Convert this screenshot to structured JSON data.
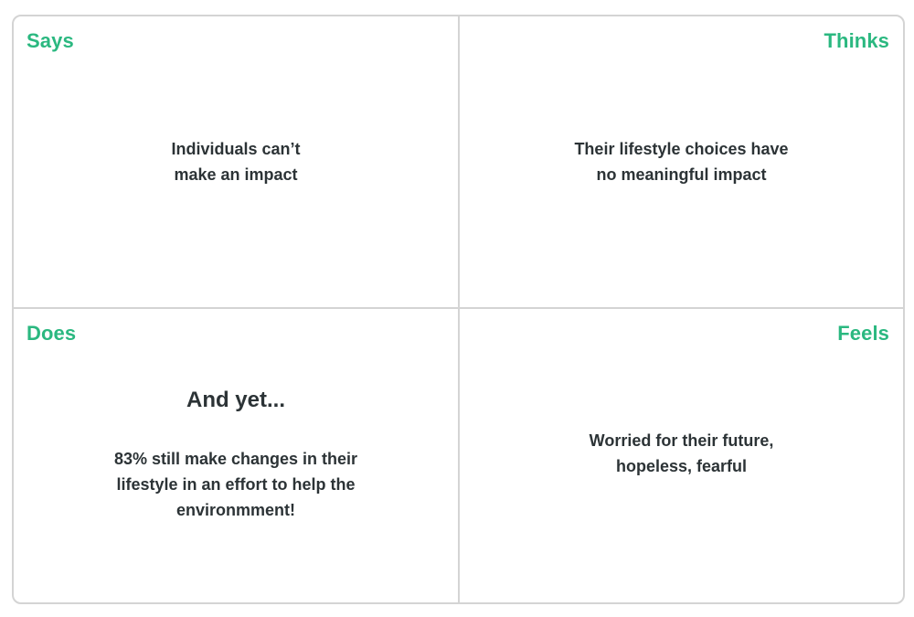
{
  "colors": {
    "accent": "#2bb880",
    "text": "#2c3336",
    "border": "#d4d4d4"
  },
  "quadrants": {
    "says": {
      "title": "Says",
      "text": "Individuals can’t\nmake an impact"
    },
    "thinks": {
      "title": "Thinks",
      "text": "Their lifestyle choices have\nno meaningful impact"
    },
    "does": {
      "title": "Does",
      "heading": "And yet...",
      "text": "83% still make changes in their\nlifestyle in an effort to help the\nenvironmment!"
    },
    "feels": {
      "title": "Feels",
      "text": "Worried for their future,\nhopeless, fearful"
    }
  }
}
